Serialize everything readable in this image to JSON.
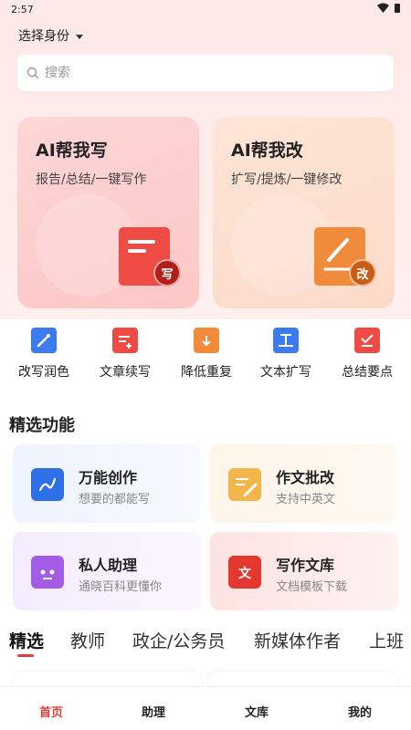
{
  "status": {
    "time": "2:57"
  },
  "header": {
    "identity_label": "选择身份"
  },
  "search": {
    "placeholder": "搜索"
  },
  "hero_cards": [
    {
      "title": "AI帮我写",
      "subtitle": "报告/总结/一键写作",
      "badge": "写"
    },
    {
      "title": "AI帮我改",
      "subtitle": "扩写/提炼/一键修改",
      "badge": "改"
    }
  ],
  "tools": [
    {
      "label": "改写润色",
      "icon": "magic-wand-icon"
    },
    {
      "label": "文章续写",
      "icon": "document-plus-icon"
    },
    {
      "label": "降低重复",
      "icon": "download-doc-icon"
    },
    {
      "label": "文本扩写",
      "icon": "expand-text-icon"
    },
    {
      "label": "总结要点",
      "icon": "checklist-icon"
    }
  ],
  "featured": {
    "title": "精选功能",
    "items": [
      {
        "title": "万能创作",
        "subtitle": "想要的都能写",
        "icon": "pen-book-icon"
      },
      {
        "title": "作文批改",
        "subtitle": "支持中英文",
        "icon": "edit-note-icon"
      },
      {
        "title": "私人助理",
        "subtitle": "通晓百科更懂你",
        "icon": "robot-icon"
      },
      {
        "title": "写作文库",
        "subtitle": "文档模板下载",
        "icon": "library-icon"
      }
    ]
  },
  "tabs": [
    "精选",
    "教师",
    "政企/公务员",
    "新媒体作者",
    "上班"
  ],
  "bottom_nav": [
    "首页",
    "助理",
    "文库",
    "我的"
  ],
  "colors": {
    "accent": "#e53b35"
  }
}
